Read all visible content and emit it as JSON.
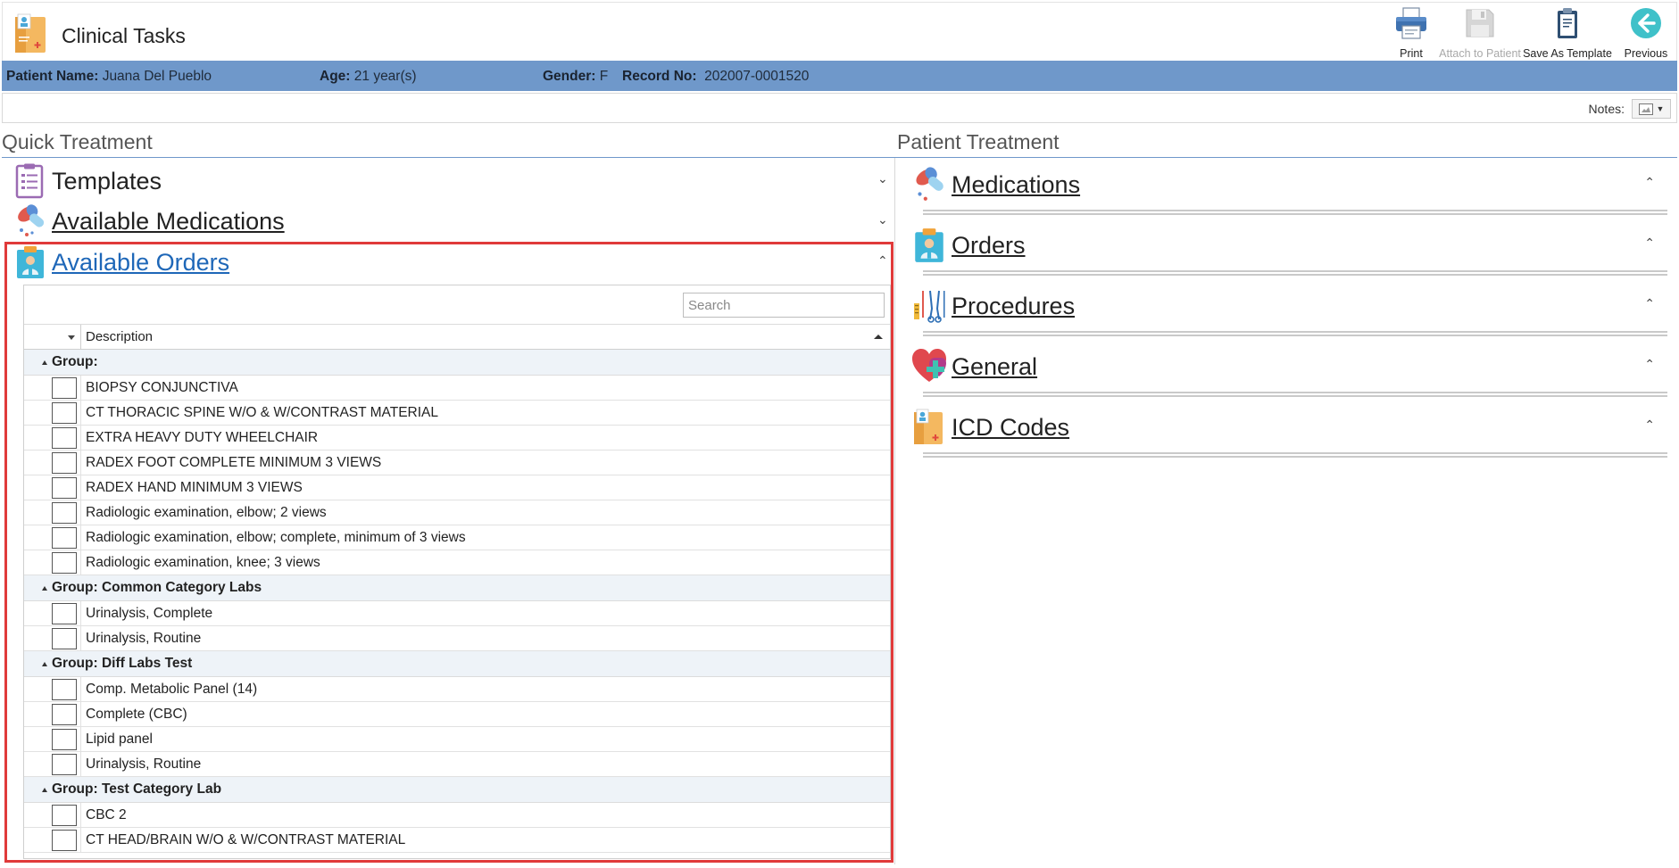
{
  "app": {
    "title": "Clinical Tasks"
  },
  "toolbar": {
    "print_label": "Print",
    "attach_label": "Attach to Patient",
    "template_label": "Save As Template",
    "previous_label": "Previous"
  },
  "patient": {
    "name_label": "Patient Name:",
    "name": "Juana Del Pueblo",
    "age_label": "Age:",
    "age": "21 year(s)",
    "gender_label": "Gender:",
    "gender": "F",
    "record_label": "Record No:",
    "record": "202007-0001520"
  },
  "notes": {
    "label": "Notes:"
  },
  "left": {
    "header": "Quick Treatment",
    "sections": {
      "templates": "Templates",
      "medications": "Available Medications",
      "orders": "Available Orders"
    },
    "grid": {
      "search_placeholder": "Search",
      "column_description": "Description",
      "groups": [
        {
          "label": "Group:",
          "rows": [
            "BIOPSY CONJUNCTIVA",
            "CT THORACIC SPINE W/O & W/CONTRAST MATERIAL",
            "EXTRA HEAVY DUTY WHEELCHAIR",
            "RADEX FOOT COMPLETE MINIMUM 3 VIEWS",
            "RADEX HAND MINIMUM 3 VIEWS",
            "Radiologic examination, elbow; 2 views",
            "Radiologic examination, elbow; complete, minimum of 3 views",
            "Radiologic examination, knee; 3 views"
          ]
        },
        {
          "label": "Group: Common Category Labs",
          "rows": [
            "Urinalysis, Complete",
            "Urinalysis, Routine"
          ]
        },
        {
          "label": "Group: Diff Labs Test",
          "rows": [
            "Comp. Metabolic Panel (14)",
            "Complete (CBC)",
            "Lipid panel",
            "Urinalysis, Routine"
          ]
        },
        {
          "label": "Group: Test Category Lab",
          "rows": [
            "CBC 2",
            "CT HEAD/BRAIN W/O & W/CONTRAST MATERIAL"
          ]
        }
      ]
    }
  },
  "right": {
    "header": "Patient Treatment",
    "sections": [
      "Medications",
      "Orders",
      "Procedures",
      "General",
      "ICD Codes"
    ]
  },
  "colors": {
    "patient_bar": "#6f98ca",
    "highlight_border": "#e03a3a",
    "link": "#1e67b8",
    "group_row_bg": "#eef3f8"
  }
}
